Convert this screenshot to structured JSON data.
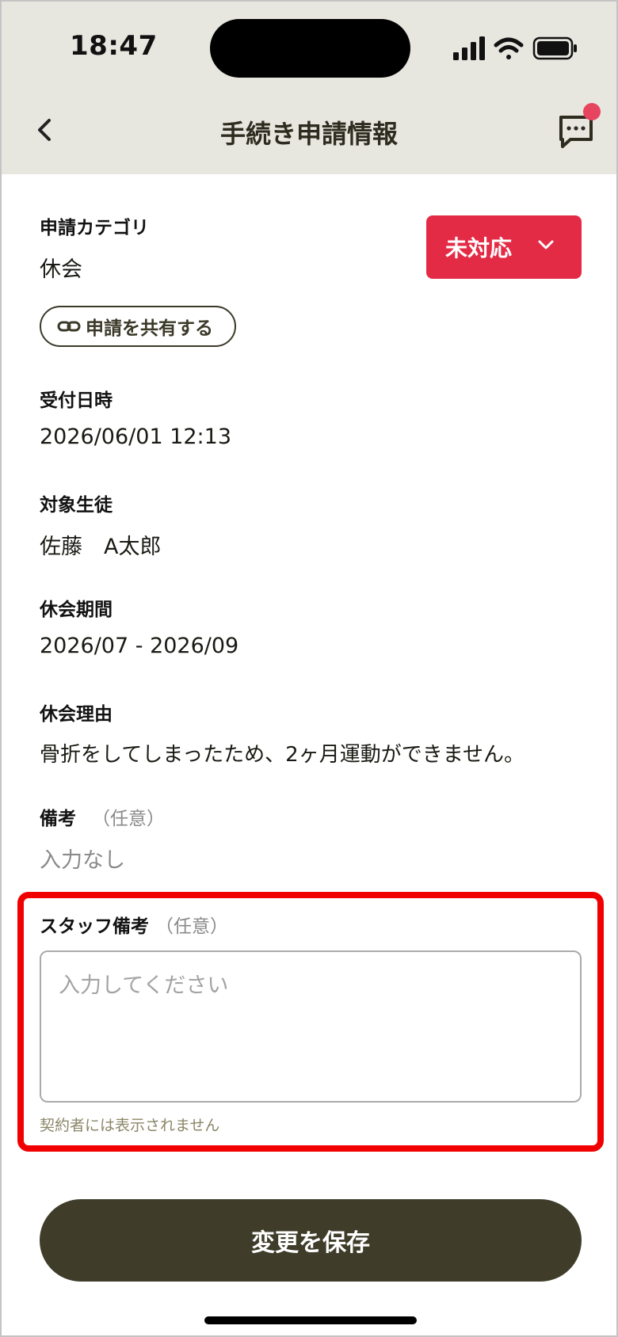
{
  "status_bar": {
    "time": "18:47"
  },
  "header": {
    "title": "手続き申請情報"
  },
  "category": {
    "label": "申請カテゴリ",
    "value": "休会"
  },
  "status": {
    "label": "未対応",
    "color": "#e42b45"
  },
  "share": {
    "label": "申請を共有する"
  },
  "received": {
    "label": "受付日時",
    "value": "2026/06/01 12:13"
  },
  "student": {
    "label": "対象生徒",
    "value": "佐藤　A太郎"
  },
  "period": {
    "label": "休会期間",
    "value": "2026/07 - 2026/09"
  },
  "reason": {
    "label": "休会理由",
    "value": "骨折をしてしまったため、2ヶ月運動ができません。"
  },
  "notes": {
    "label": "備考",
    "optional": "（任意）",
    "value": "入力なし"
  },
  "staff_notes": {
    "label": "スタッフ備考",
    "optional": "（任意）",
    "placeholder": "入力してください",
    "hint": "契約者には表示されません"
  },
  "save": {
    "label": "変更を保存"
  }
}
